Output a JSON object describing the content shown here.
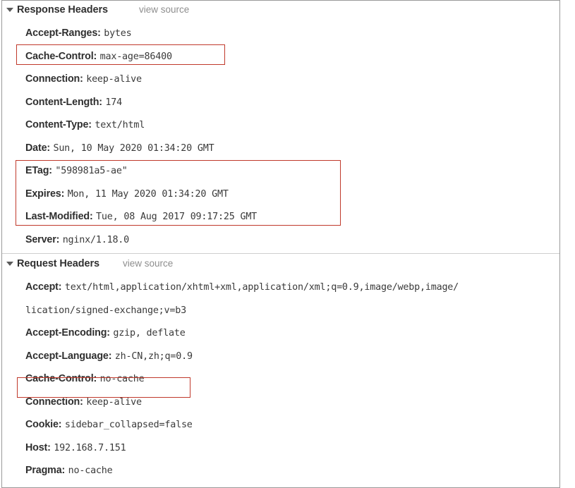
{
  "panel": {
    "accent_color": "#c0392b",
    "text_color": "#2f2f2f",
    "value_color": "#3a3a3a",
    "muted_color": "#8e8e8e"
  },
  "response_section": {
    "title": "Response Headers",
    "view_source_label": "view source",
    "disclosure_icon": "triangle-down-icon",
    "expanded": true,
    "headers": [
      {
        "name": "Accept-Ranges:",
        "value": "bytes"
      },
      {
        "name": "Cache-Control:",
        "value": "max-age=86400"
      },
      {
        "name": "Connection:",
        "value": "keep-alive"
      },
      {
        "name": "Content-Length:",
        "value": "174"
      },
      {
        "name": "Content-Type:",
        "value": "text/html"
      },
      {
        "name": "Date:",
        "value": "Sun, 10 May 2020 01:34:20 GMT"
      },
      {
        "name": "ETag:",
        "value": "\"598981a5-ae\""
      },
      {
        "name": "Expires:",
        "value": "Mon, 11 May 2020 01:34:20 GMT"
      },
      {
        "name": "Last-Modified:",
        "value": "Tue, 08 Aug 2017 09:17:25 GMT"
      },
      {
        "name": "Server:",
        "value": "nginx/1.18.0"
      }
    ]
  },
  "request_section": {
    "title": "Request Headers",
    "view_source_label": "view source",
    "disclosure_icon": "triangle-down-icon",
    "expanded": true,
    "headers": [
      {
        "name": "Accept:",
        "value": "text/html,application/xhtml+xml,application/xml;q=0.9,image/webp,image/"
      },
      {
        "name": "",
        "value": "lication/signed-exchange;v=b3"
      },
      {
        "name": "Accept-Encoding:",
        "value": "gzip, deflate"
      },
      {
        "name": "Accept-Language:",
        "value": "zh-CN,zh;q=0.9"
      },
      {
        "name": "Cache-Control:",
        "value": "no-cache"
      },
      {
        "name": "Connection:",
        "value": "keep-alive"
      },
      {
        "name": "Cookie:",
        "value": "sidebar_collapsed=false"
      },
      {
        "name": "Host:",
        "value": "192.168.7.151"
      },
      {
        "name": "Pragma:",
        "value": "no-cache"
      }
    ]
  },
  "annotations": [
    {
      "id": "box-response-cache-control",
      "target": "Cache-Control: max-age=86400",
      "color": "#c0392b"
    },
    {
      "id": "box-response-etag-group",
      "target": "ETag / Expires / Last-Modified",
      "color": "#c0392b"
    },
    {
      "id": "box-request-cache-control",
      "target": "Cache-Control: no-cache",
      "color": "#c0392b"
    }
  ]
}
